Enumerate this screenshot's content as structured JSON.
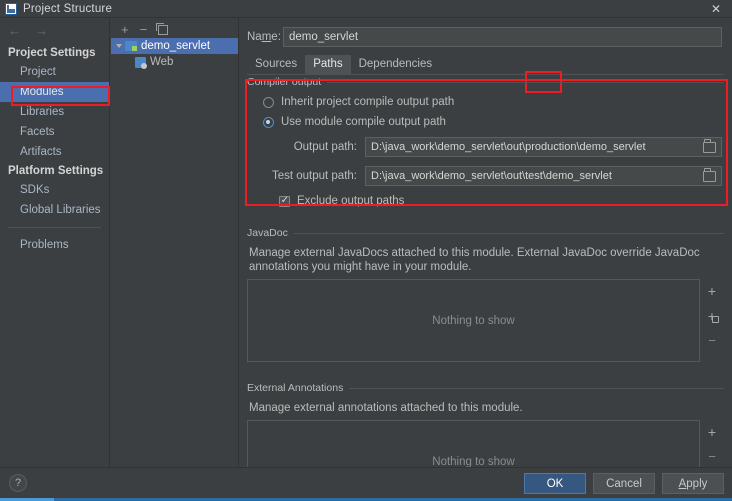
{
  "window": {
    "title": "Project Structure",
    "app_icon": "idea-module-icon",
    "close_label": "✕"
  },
  "sidebar": {
    "back_icon": "arrow-left-icon",
    "forward_icon": "arrow-right-icon",
    "groups": [
      {
        "label": "Project Settings",
        "items": [
          {
            "label": "Project",
            "selected": false
          },
          {
            "label": "Modules",
            "selected": true
          },
          {
            "label": "Libraries",
            "selected": false
          },
          {
            "label": "Facets",
            "selected": false
          },
          {
            "label": "Artifacts",
            "selected": false
          }
        ]
      },
      {
        "label": "Platform Settings",
        "items": [
          {
            "label": "SDKs",
            "selected": false
          },
          {
            "label": "Global Libraries",
            "selected": false
          }
        ]
      }
    ],
    "problems": {
      "label": "Problems"
    }
  },
  "tree_panel": {
    "toolbar": {
      "add_label": "+",
      "remove_label": "−",
      "copy_icon": "copy-icon"
    },
    "nodes": [
      {
        "label": "demo_servlet",
        "icon": "module-icon",
        "selected": true,
        "expanded": true,
        "indent": 0
      },
      {
        "label": "Web",
        "icon": "web-facet-icon",
        "selected": false,
        "indent": 1
      }
    ]
  },
  "main": {
    "name_label": "Name:",
    "name_value": "demo_servlet",
    "name_placeholder": "",
    "tabs": [
      {
        "label": "Sources",
        "active": false
      },
      {
        "label": "Paths",
        "active": true
      },
      {
        "label": "Dependencies",
        "active": false
      }
    ],
    "compiler_output": {
      "title": "Compiler output",
      "radios": [
        {
          "label": "Inherit project compile output path",
          "checked": false
        },
        {
          "label": "Use module compile output path",
          "checked": true
        }
      ],
      "output_path": {
        "label": "Output path:",
        "value": "D:\\java_work\\demo_servlet\\out\\production\\demo_servlet",
        "browse_icon": "folder-icon"
      },
      "test_output_path": {
        "label": "Test output path:",
        "value": "D:\\java_work\\demo_servlet\\out\\test\\demo_servlet",
        "browse_icon": "folder-icon"
      },
      "exclude_checkbox": {
        "label": "Exclude output paths",
        "checked": true
      }
    },
    "javadoc": {
      "title": "JavaDoc",
      "description": "Manage external JavaDocs attached to this module. External JavaDoc override JavaDoc annotations you might have in your module.",
      "empty_text": "Nothing to show",
      "buttons": [
        {
          "icon": "plus-icon",
          "label": "+"
        },
        {
          "icon": "plus-module-icon",
          "label": "+"
        },
        {
          "icon": "minus-icon",
          "label": "−"
        }
      ]
    },
    "external_annotations": {
      "title": "External Annotations",
      "description": "Manage external annotations attached to this module.",
      "empty_text": "Nothing to show",
      "buttons": [
        {
          "icon": "plus-icon",
          "label": "+"
        },
        {
          "icon": "minus-icon",
          "label": "−"
        }
      ]
    }
  },
  "footer": {
    "help_label": "?",
    "ok_label": "OK",
    "cancel_label": "Cancel",
    "apply_label": "Apply"
  },
  "annotations": {
    "highlight_color": "#ee1c25",
    "boxes": [
      "modules-sidebar-item",
      "paths-tab",
      "compiler-output-group"
    ]
  },
  "colors": {
    "background": "#3c3f41",
    "selection": "#4b6eaf",
    "primary_button": "#365880",
    "accent_line": "#2d6ca2",
    "highlight": "#ee1c25"
  }
}
